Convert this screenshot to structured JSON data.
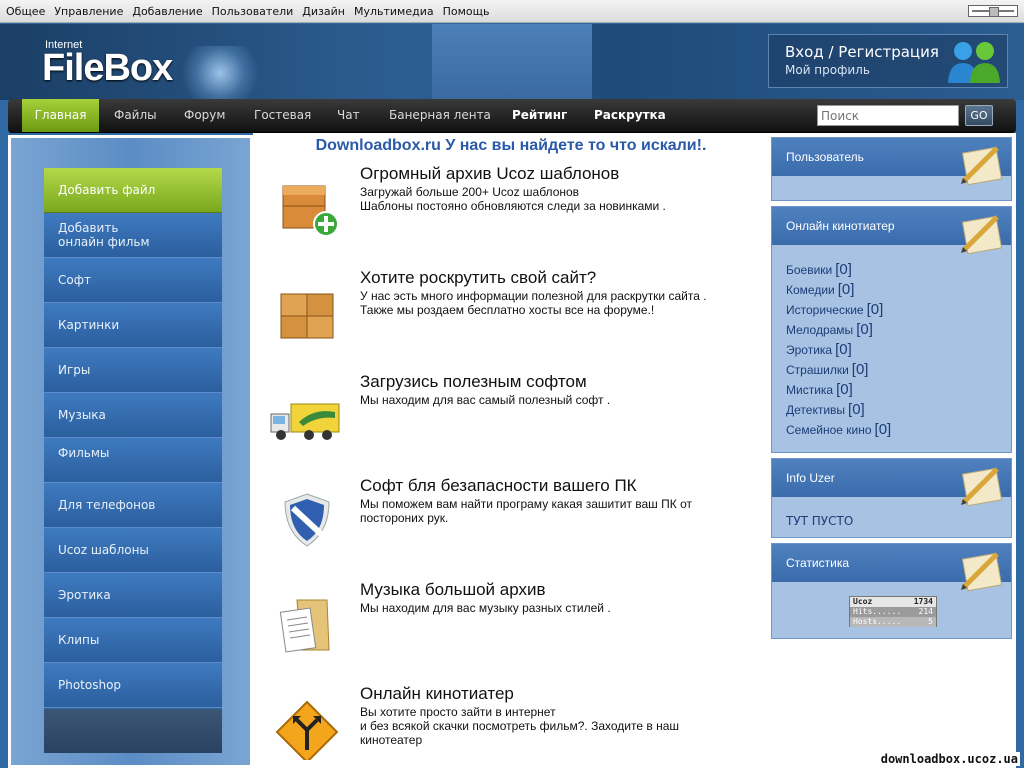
{
  "admin_menu": [
    "Общее",
    "Управление",
    "Добавление",
    "Пользователи",
    "Дизайн",
    "Мультимедиа",
    "Помощь"
  ],
  "logo": {
    "small": "Internet",
    "big": "FileBox"
  },
  "auth": {
    "login": "Вход / Регистрация",
    "profile": "Мой профиль"
  },
  "nav": {
    "items": [
      "Главная",
      "Файлы",
      "Форум",
      "Гостевая",
      "Чат",
      "Банерная лента",
      "Рейтинг",
      "Раскрутка"
    ],
    "active": 0
  },
  "search": {
    "placeholder": "Поиск",
    "button": "GO"
  },
  "left_menu": [
    "Добавить файл",
    "Добавить\nонлайн фильм",
    "Софт",
    "Картинки",
    "Игры",
    "Музыка",
    "Фильмы",
    "Для телефонов",
    "Ucoz шаблоны",
    "Эротика",
    "Клипы",
    "Photoshop"
  ],
  "headline": "Downloadbox.ru У нас вы найдете то что искали!.",
  "entries": [
    {
      "title": "Огромный архив Ucoz шаблонов",
      "desc": "Загружай больше 200+ Ucoz шаблонов\nШаблоны постояно обновляются следи за новинками .",
      "icon": "box-add-icon"
    },
    {
      "title": "Хотите роскрутить свой сайт?",
      "desc": "У нас эсть много информации полезной для раскрутки сайта .\nТакже мы роздаем бесплатно хосты все на форуме.!",
      "icon": "boxes-icon"
    },
    {
      "title": "Загрузись полезным софтом",
      "desc": "Мы находим для вас самый полезный софт .",
      "icon": "truck-icon"
    },
    {
      "title": "Софт бля безапасности вашего ПК",
      "desc": "Мы поможем вам найти програму какая зашитит ваш ПК от посторониx рук.",
      "icon": "shield-icon"
    },
    {
      "title": "Музыка большой архив",
      "desc": "Мы находим для вас музыку разных стилей .",
      "icon": "folder-document-icon"
    },
    {
      "title": "Онлайн кинотиатер",
      "desc": "Вы хотите просто зайти в интернет\nи без всякой скачки посмотреть фильм?. Заходите в наш кинотеатер",
      "icon": "road-sign-icon"
    }
  ],
  "right": {
    "user_title": "Пользователь",
    "kino_title": "Онлайн кинотиатер",
    "kino": [
      {
        "name": "Боевики",
        "count": "[0]"
      },
      {
        "name": "Комедии",
        "count": "[0]"
      },
      {
        "name": "Исторические",
        "count": "[0]"
      },
      {
        "name": "Мелодрамы",
        "count": "[0]"
      },
      {
        "name": "Эротика",
        "count": "[0]"
      },
      {
        "name": "Страшилки",
        "count": "[0]"
      },
      {
        "name": "Мистика",
        "count": "[0]"
      },
      {
        "name": "Детективы",
        "count": "[0]"
      },
      {
        "name": "Семейное кино",
        "count": "[0]"
      }
    ],
    "info_title": "Info Uzer",
    "info_text": "ТУТ ПУСТО",
    "stats_title": "Статистика",
    "counter": {
      "brand": "Ucoz",
      "total": "1734",
      "hits_label": "Hits......",
      "hits": "214",
      "hosts_label": "Hosts.....",
      "hosts": "5"
    }
  },
  "watermark": "downloadbox.ucoz.ua",
  "colors": {
    "accent_green": "#8dbb2a",
    "nav_dark": "#1a1a1a",
    "brand_blue": "#2a5aa8"
  }
}
